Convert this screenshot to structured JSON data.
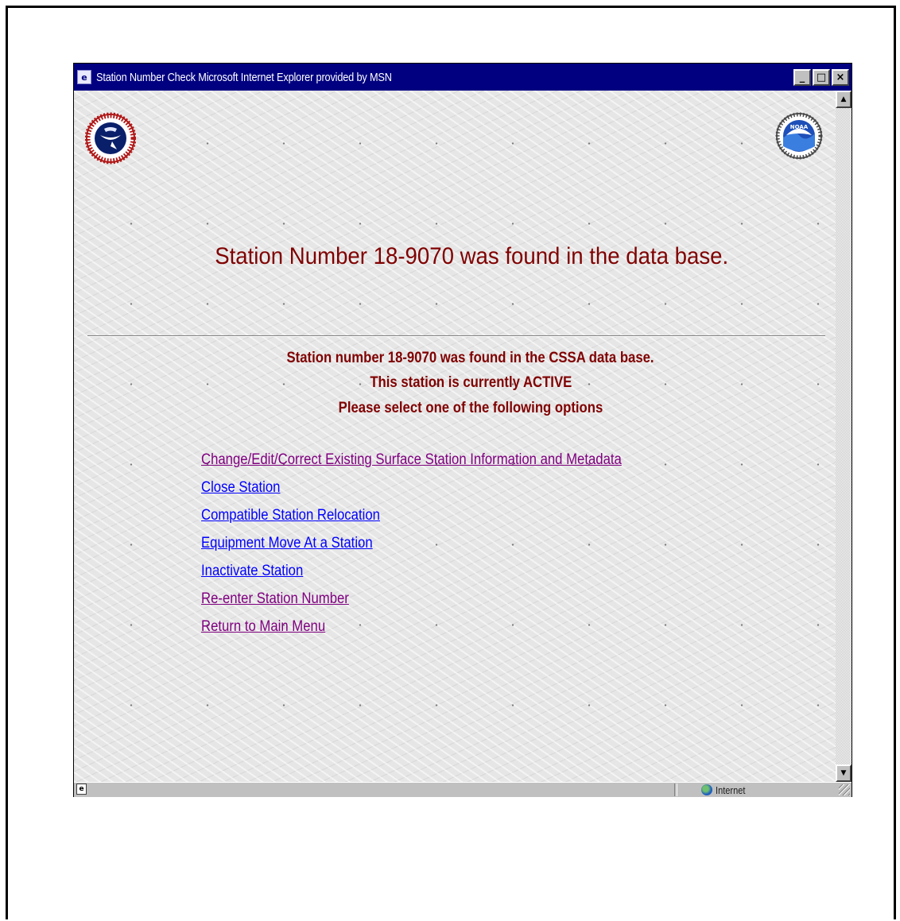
{
  "window": {
    "title": "Station Number Check   Microsoft Internet Explorer provided by MSN",
    "controls": {
      "minimize": "_",
      "maximize": "□",
      "close": "×"
    }
  },
  "logos": {
    "left": "nws-seal",
    "right": "noaa-seal",
    "noaa_text": "NOAA"
  },
  "page": {
    "heading": "Station Number 18-9070 was found in the data base.",
    "messages": [
      "Station number 18-9070 was found in the CSSA data base.",
      "This station is currently ACTIVE",
      "Please select one of the following options"
    ],
    "links": [
      {
        "label": "Change/Edit/Correct Existing Surface Station Information and Metadata",
        "state": "visited"
      },
      {
        "label": "Close Station",
        "state": "unvisited"
      },
      {
        "label": "Compatible Station Relocation",
        "state": "unvisited"
      },
      {
        "label": "Equipment Move At a Station",
        "state": "unvisited"
      },
      {
        "label": "Inactivate Station",
        "state": "unvisited"
      },
      {
        "label": "Re-enter Station Number",
        "state": "visited"
      },
      {
        "label": "Return to Main Menu",
        "state": "visited"
      }
    ]
  },
  "status_bar": {
    "zone": "Internet",
    "zone_icon": "globe-icon",
    "page_icon": "ie-page-icon"
  },
  "colors": {
    "titlebar": "#000080",
    "heading": "#800000",
    "link_visited": "#800080",
    "link_unvisited": "#0000ff"
  }
}
